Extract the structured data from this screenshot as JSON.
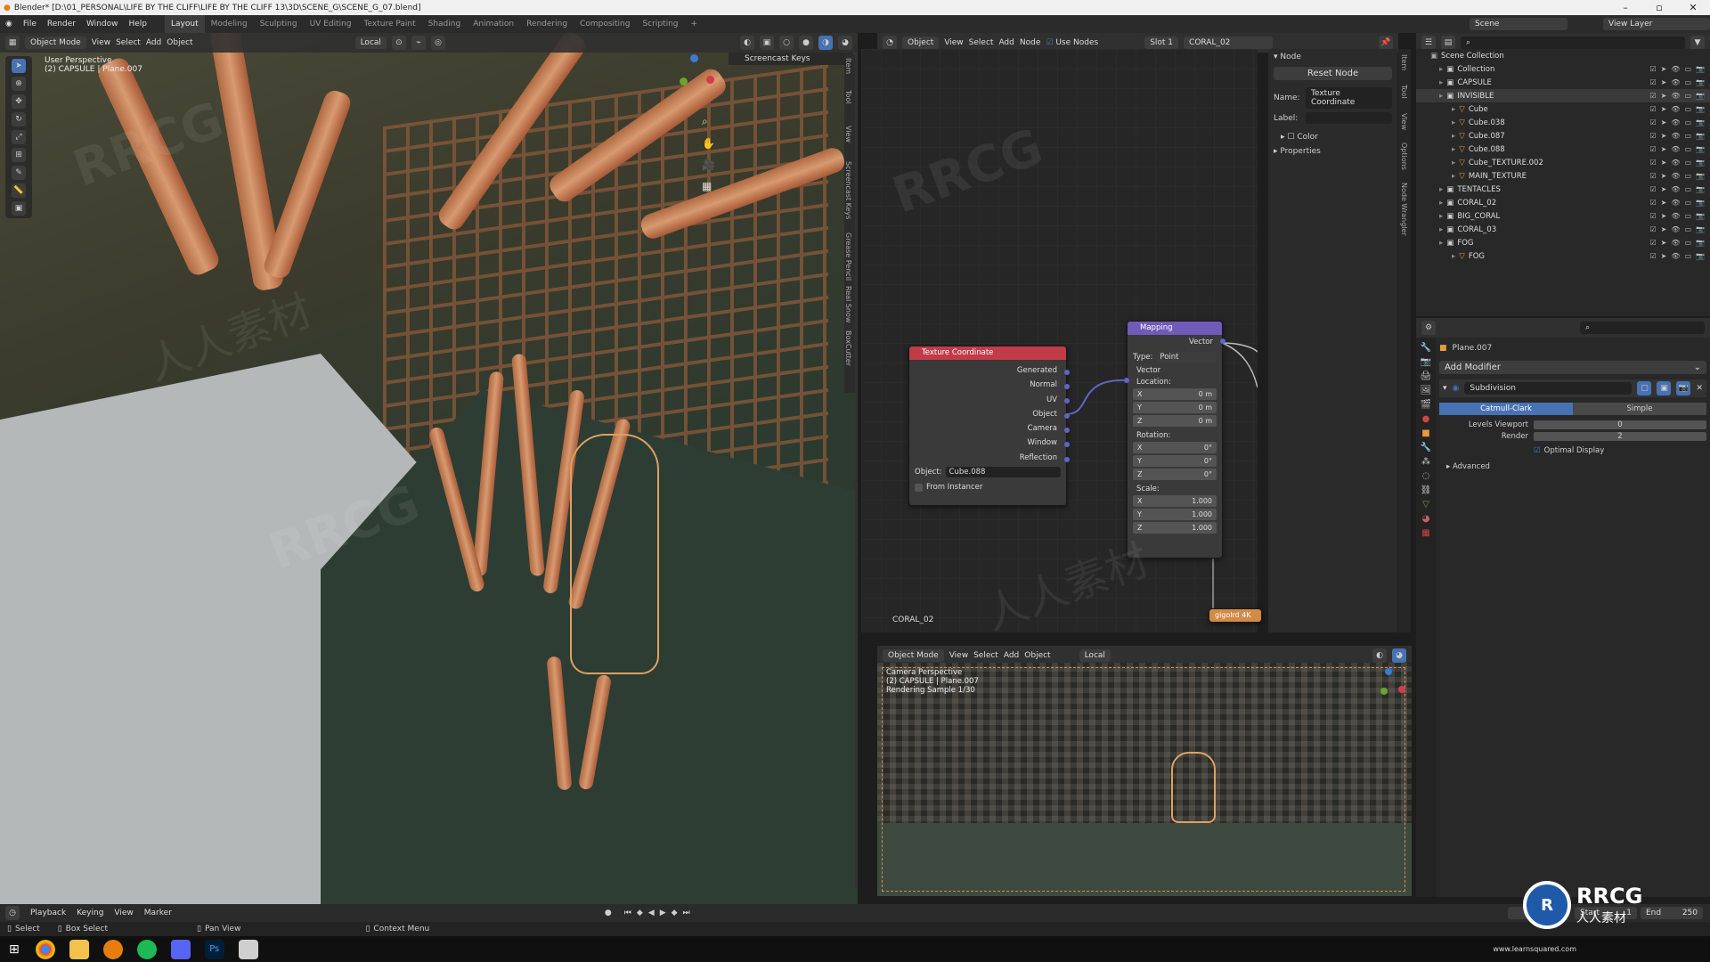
{
  "window": {
    "title": "Blender* [D:\\01_PERSONAL\\LIFE BY THE CLIFF\\LIFE BY THE CLIFF 13\\3D\\SCENE_G\\SCENE_G_07.blend]"
  },
  "menus": [
    "File",
    "Render",
    "Window",
    "Help"
  ],
  "workspaces": [
    "Layout",
    "Modeling",
    "Sculpting",
    "UV Editing",
    "Texture Paint",
    "Shading",
    "Animation",
    "Rendering",
    "Compositing",
    "Scripting"
  ],
  "top_right": {
    "scene": "Scene",
    "view_layer": "View Layer"
  },
  "viewport": {
    "mode": "Object Mode",
    "menus": [
      "View",
      "Select",
      "Add",
      "Object"
    ],
    "orientation": "Local",
    "info_line1": "User Perspective",
    "info_line2": "(2) CAPSULE | Plane.007",
    "tabs": [
      "Item",
      "Tool",
      "View",
      "Screencast Keys",
      "Grease Pencil",
      "Real Snow",
      "BoxCutter"
    ],
    "overlay_label": "Screencast Keys"
  },
  "node_editor": {
    "type": "Object",
    "menus": [
      "View",
      "Select",
      "Add",
      "Node"
    ],
    "use_nodes": "Use Nodes",
    "slot": "Slot 1",
    "material": "CORAL_02",
    "object_label": "CORAL_02",
    "texcoord": {
      "title": "Texture Coordinate",
      "outputs": [
        "Generated",
        "Normal",
        "UV",
        "Object",
        "Camera",
        "Window",
        "Reflection"
      ],
      "object_label": "Object:",
      "object_value": "Cube.088",
      "from_instancer": "From Instancer"
    },
    "mapping": {
      "title": "Mapping",
      "output": "Vector",
      "type_label": "Type:",
      "type_value": "Point",
      "vector": "Vector",
      "location": "Location:",
      "rotation": "Rotation:",
      "scale": "Scale:",
      "loc": [
        "0 m",
        "0 m",
        "0 m"
      ],
      "rot": [
        "0°",
        "0°",
        "0°"
      ],
      "scl": [
        "1.000",
        "1.000",
        "1.000"
      ],
      "axes": [
        "X",
        "Y",
        "Z"
      ]
    },
    "image_node": "gigolrd 4K",
    "side_tabs": [
      "Item",
      "Tool",
      "View",
      "Options",
      "Node Wrangler"
    ]
  },
  "node_panel": {
    "header": "Node",
    "reset": "Reset Node",
    "name_label": "Name:",
    "name_value": "Texture Coordinate",
    "label_label": "Label:",
    "color": "Color",
    "properties": "Properties"
  },
  "outliner": {
    "root": "Scene Collection",
    "items": [
      {
        "name": "Collection",
        "level": 1
      },
      {
        "name": "CAPSULE",
        "level": 1
      },
      {
        "name": "INVISIBLE",
        "level": 1
      },
      {
        "name": "Cube",
        "level": 2
      },
      {
        "name": "Cube.038",
        "level": 2
      },
      {
        "name": "Cube.087",
        "level": 2
      },
      {
        "name": "Cube.088",
        "level": 2
      },
      {
        "name": "Cube_TEXTURE.002",
        "level": 2
      },
      {
        "name": "MAIN_TEXTURE",
        "level": 2
      },
      {
        "name": "TENTACLES",
        "level": 1
      },
      {
        "name": "CORAL_02",
        "level": 1
      },
      {
        "name": "BIG_CORAL",
        "level": 1
      },
      {
        "name": "CORAL_03",
        "level": 1
      },
      {
        "name": "FOG",
        "level": 1
      },
      {
        "name": "FOG",
        "level": 2
      }
    ]
  },
  "properties": {
    "object": "Plane.007",
    "add_modifier": "Add Modifier",
    "modifier": "Subdivision",
    "catmull": "Catmull-Clark",
    "simple": "Simple",
    "levels_label": "Levels Viewport",
    "levels": "0",
    "render_label": "Render",
    "render": "2",
    "optimal": "Optimal Display",
    "advanced": "Advanced"
  },
  "camera_view": {
    "mode": "Object Mode",
    "menus": [
      "View",
      "Select",
      "Add",
      "Object"
    ],
    "orientation": "Local",
    "line1": "Camera Perspective",
    "line2": "(2) CAPSULE | Plane.007",
    "line3": "Rendering Sample 1/30"
  },
  "timeline": {
    "menus": [
      "Playback",
      "Keying",
      "View",
      "Marker"
    ],
    "frame": "2",
    "start_label": "Start",
    "start": "1",
    "end_label": "End",
    "end": "250"
  },
  "status": {
    "select": "Select",
    "box": "Box Select",
    "pan": "Pan View",
    "context": "Context Menu"
  },
  "watermarks": {
    "rrcg": "RRCG",
    "cn": "人人素材",
    "site": "www.learnsquared.com"
  },
  "colors": {
    "accent": "#4772b3",
    "texcoord_header": "#c13b49",
    "mapping_header": "#6f5bb8",
    "socket": "#6363c7",
    "coral": "#c9825a"
  }
}
